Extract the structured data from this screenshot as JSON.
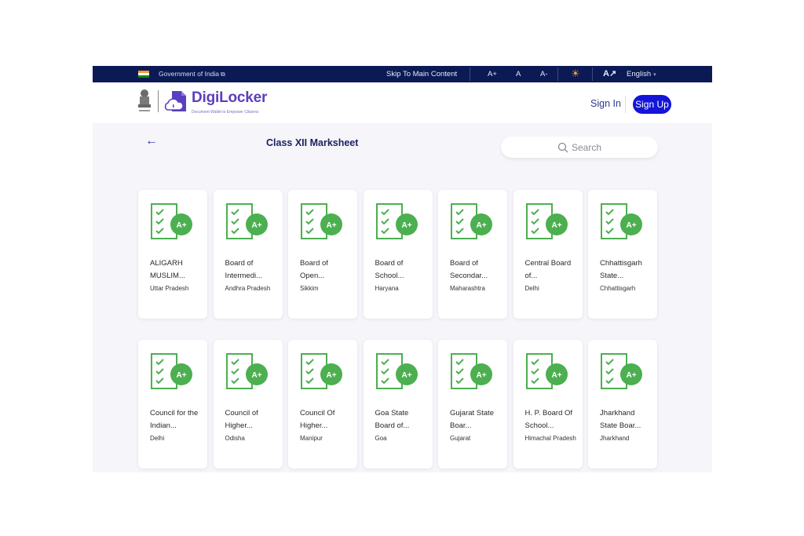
{
  "gov_bar": {
    "gov_label": "Government of India",
    "skip_label": "Skip To Main Content",
    "font_increase": "A+",
    "font_normal": "A",
    "font_decrease": "A-",
    "language": "English"
  },
  "header": {
    "brand": "DigiLocker",
    "tagline": "Document Wallet to Empower Citizens",
    "sign_in": "Sign In",
    "sign_up": "Sign Up",
    "brand_color": "#5a3fc0",
    "signup_color": "#1414d9"
  },
  "page": {
    "title": "Class XII Marksheet",
    "search_placeholder": "Search"
  },
  "icons": {
    "card_icon": "marksheet-a-plus-icon",
    "icon_color": "#4caf50"
  },
  "boards": [
    {
      "name": "ALIGARH MUSLIM...",
      "state": "Uttar Pradesh"
    },
    {
      "name": "Board of Intermedi...",
      "state": "Andhra Pradesh"
    },
    {
      "name": "Board of Open...",
      "state": "Sikkim"
    },
    {
      "name": "Board of School...",
      "state": "Haryana"
    },
    {
      "name": "Board of Secondar...",
      "state": "Maharashtra"
    },
    {
      "name": "Central Board of...",
      "state": "Delhi"
    },
    {
      "name": "Chhattisgarh State...",
      "state": "Chhattisgarh"
    },
    {
      "name": "Council for the Indian...",
      "state": "Delhi"
    },
    {
      "name": "Council of Higher...",
      "state": "Odisha"
    },
    {
      "name": "Council Of Higher...",
      "state": "Manipur"
    },
    {
      "name": "Goa State Board of...",
      "state": "Goa"
    },
    {
      "name": "Gujarat State Boar...",
      "state": "Gujarat"
    },
    {
      "name": "H. P. Board Of School...",
      "state": "Himachal Pradesh"
    },
    {
      "name": "Jharkhand State Boar...",
      "state": "Jharkhand"
    }
  ]
}
